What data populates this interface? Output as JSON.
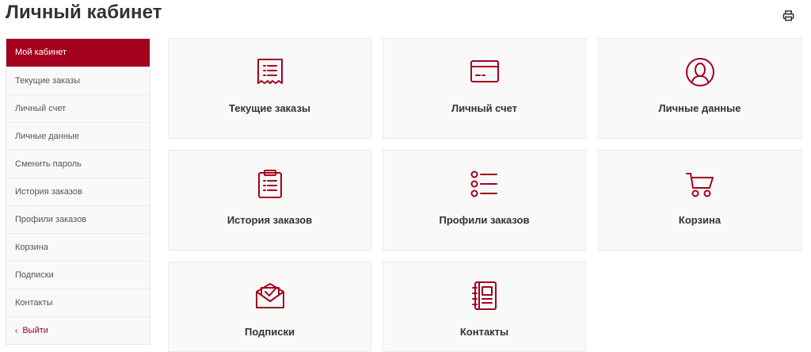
{
  "page": {
    "title": "Личный кабинет"
  },
  "header": {
    "print_icon": "printer-icon"
  },
  "accent_color": "#a5001e",
  "sidebar": {
    "items": [
      {
        "label": "Мой кабинет",
        "active": true
      },
      {
        "label": "Текущие заказы"
      },
      {
        "label": "Личный счет"
      },
      {
        "label": "Личные данные"
      },
      {
        "label": "Сменить пароль"
      },
      {
        "label": "История заказов"
      },
      {
        "label": "Профили заказов"
      },
      {
        "label": "Корзина"
      },
      {
        "label": "Подписки"
      },
      {
        "label": "Контакты"
      }
    ],
    "logout": {
      "label": "Выйти",
      "icon": "chevron-left-icon"
    }
  },
  "tiles": [
    {
      "label": "Текущие заказы",
      "icon": "receipt-list-icon"
    },
    {
      "label": "Личный счет",
      "icon": "credit-card-icon"
    },
    {
      "label": "Личные данные",
      "icon": "user-circle-icon"
    },
    {
      "label": "История заказов",
      "icon": "clipboard-list-icon"
    },
    {
      "label": "Профили заказов",
      "icon": "bullet-list-icon"
    },
    {
      "label": "Корзина",
      "icon": "shopping-cart-icon"
    },
    {
      "label": "Подписки",
      "icon": "envelope-check-icon"
    },
    {
      "label": "Контакты",
      "icon": "address-book-icon"
    }
  ]
}
